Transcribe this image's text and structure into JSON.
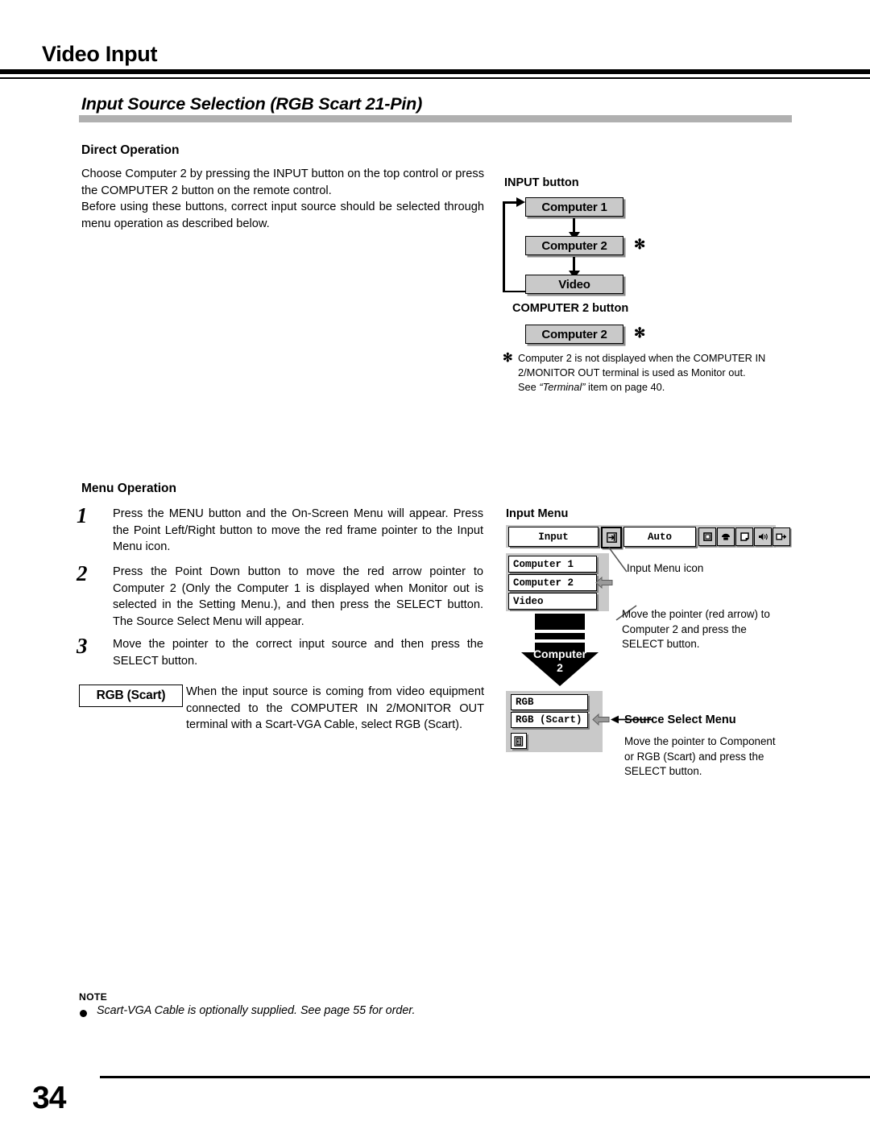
{
  "header": {
    "chapter_title": "Video Input",
    "section_title": "Input Source Selection (RGB Scart 21-Pin)"
  },
  "direct_operation": {
    "heading": "Direct Operation",
    "paragraph1": "Choose Computer 2 by pressing the INPUT button on the top control or press the COMPUTER 2 button on the remote control.",
    "paragraph2": "Before using these buttons, correct input source should be selected through menu operation as described below."
  },
  "input_button_figure": {
    "caption": "INPUT button",
    "boxes": [
      "Computer 1",
      "Computer 2",
      "Video"
    ],
    "asterisk": "✻",
    "computer2_caption": "COMPUTER 2 button",
    "computer2_box": "Computer 2",
    "footnote_marker": "✻",
    "footnote_line1": "Computer 2 is not displayed when the COMPUTER IN",
    "footnote_line2": "2/MONITOR OUT terminal is used as Monitor out.",
    "footnote_line3_pre": "See ",
    "footnote_line3_em": "“Terminal”",
    "footnote_line3_post": " item on page 40."
  },
  "menu_operation": {
    "heading": "Menu Operation",
    "steps": [
      {
        "num": "1",
        "text": "Press the MENU button and the On-Screen Menu will appear. Press the Point Left/Right button to move the red frame pointer to the Input Menu icon."
      },
      {
        "num": "2",
        "text": "Press the Point Down button to move the red arrow pointer to Computer 2 (Only the Computer 1 is displayed when Monitor out is selected in the Setting Menu.), and then press the SELECT button.  The Source Select Menu will appear."
      },
      {
        "num": "3",
        "text": "Move the pointer to the correct input source and then press the SELECT button."
      }
    ],
    "scart_label": "RGB (Scart)",
    "scart_text": "When the input source is coming from video equipment connected to the COMPUTER IN 2/MONITOR OUT terminal with a Scart-VGA Cable, select RGB (Scart)."
  },
  "input_menu_figure": {
    "caption": "Input Menu",
    "menubar_label": "Input",
    "menubar_auto": "Auto",
    "icons": [
      "input-menu-icon",
      "screen-icon",
      "color-adjust-icon",
      "image-icon",
      "sound-icon",
      "setting-icon"
    ],
    "list_items": [
      "Computer 1",
      "Computer 2",
      "Video"
    ],
    "callout_icon": "Input Menu icon",
    "callout_pointer": "Move the pointer (red arrow) to Computer 2 and press the SELECT button.",
    "arrow_label_line1": "Computer",
    "arrow_label_line2": "2"
  },
  "source_select_figure": {
    "items": [
      "RGB",
      "RGB (Scart)"
    ],
    "exit_icon": "exit-door-icon",
    "title": "Source Select Menu",
    "description": "Move the pointer to Component or RGB (Scart) and press the SELECT button."
  },
  "note": {
    "heading": "NOTE",
    "text": "Scart-VGA Cable is optionally supplied.  See page 55 for order."
  },
  "footer": {
    "page_number": "34"
  }
}
